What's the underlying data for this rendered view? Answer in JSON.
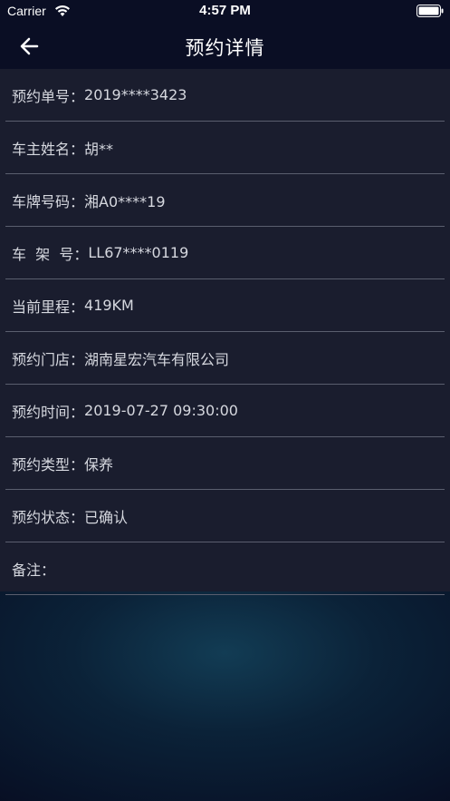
{
  "status_bar": {
    "carrier": "Carrier",
    "time": "4:57 PM",
    "icons": [
      "wifi-icon",
      "battery-icon"
    ]
  },
  "nav": {
    "back_icon": "arrow-left-icon",
    "title": "预约详情"
  },
  "details": [
    {
      "label": "预约单号：",
      "value": "2019****3423"
    },
    {
      "label": "车主姓名：",
      "value": "胡**"
    },
    {
      "label": "车牌号码：",
      "value": "湘A0****19"
    },
    {
      "label": "车  架  号：",
      "value": "LL67****0119"
    },
    {
      "label": "当前里程：",
      "value": "419KM"
    },
    {
      "label": "预约门店：",
      "value": "湖南星宏汽车有限公司"
    },
    {
      "label": "预约时间：",
      "value": "2019-07-27 09:30:00"
    },
    {
      "label": "预约类型：",
      "value": "保养"
    },
    {
      "label": "预约状态：",
      "value": "已确认"
    },
    {
      "label": "备注：",
      "value": ""
    }
  ],
  "colors": {
    "background": "#070d22",
    "panel": "#1a1d2e",
    "divider": "#5a5e6e",
    "text": "#d6d8df"
  }
}
